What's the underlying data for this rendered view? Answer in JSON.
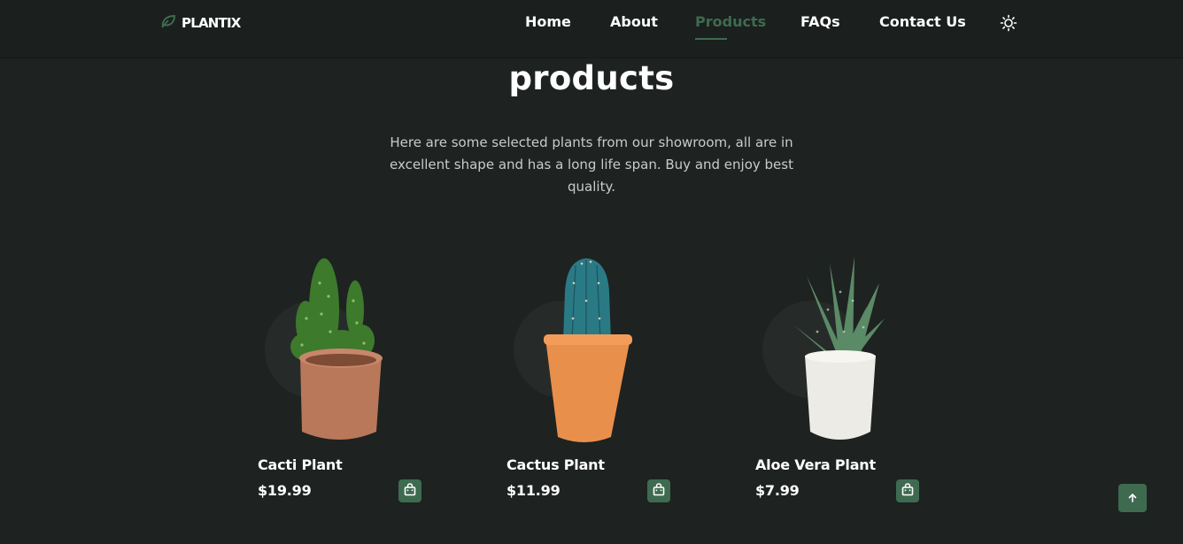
{
  "brand": {
    "name": "PLANTIX",
    "icon": "leaf-icon"
  },
  "nav": {
    "items": [
      {
        "label": "Home",
        "active": false
      },
      {
        "label": "About",
        "active": false
      },
      {
        "label": "Products",
        "active": true
      },
      {
        "label": "FAQs",
        "active": false
      },
      {
        "label": "Contact Us",
        "active": false
      }
    ],
    "theme_toggle_icon": "sun-icon"
  },
  "section": {
    "title": "products",
    "description": "Here are some selected plants from our showroom, all are in excellent shape and has a long life span. Buy and enjoy best quality."
  },
  "products": [
    {
      "name": "Cacti Plant",
      "price": "$19.99",
      "image": "cacti-plant-image",
      "cart_icon": "shopping-bag-icon"
    },
    {
      "name": "Cactus Plant",
      "price": "$11.99",
      "image": "cactus-plant-image",
      "cart_icon": "shopping-bag-icon"
    },
    {
      "name": "Aloe Vera Plant",
      "price": "$7.99",
      "image": "aloe-vera-plant-image",
      "cart_icon": "shopping-bag-icon"
    }
  ],
  "scroll_top_icon": "arrow-up-icon",
  "colors": {
    "background": "#1e2221",
    "header": "#1b1f1e",
    "accent": "#3e6b50",
    "text": "#ffffff",
    "muted_text": "#c7ccca"
  }
}
